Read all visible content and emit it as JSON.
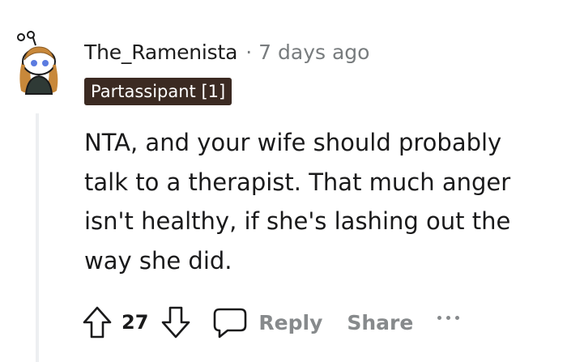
{
  "comment": {
    "username": "The_Ramenista",
    "separator": "·",
    "timestamp": "7 days ago",
    "flair": "Partassipant [1]",
    "body": "NTA, and your wife should probably talk to a therapist. That much anger isn't healthy, if she's lashing out the way she did.",
    "avatar_icon": "snoo-avatar-icon"
  },
  "actions": {
    "upvote_icon": "upvote-arrow-icon",
    "vote_count": "27",
    "downvote_icon": "downvote-arrow-icon",
    "reply_icon": "speech-bubble-icon",
    "reply_label": "Reply",
    "share_label": "Share",
    "more_icon": "ellipsis-icon"
  },
  "colors": {
    "flair_background": "#3b2a22",
    "muted_text": "#878a8c",
    "thread_line": "#edeff1"
  }
}
